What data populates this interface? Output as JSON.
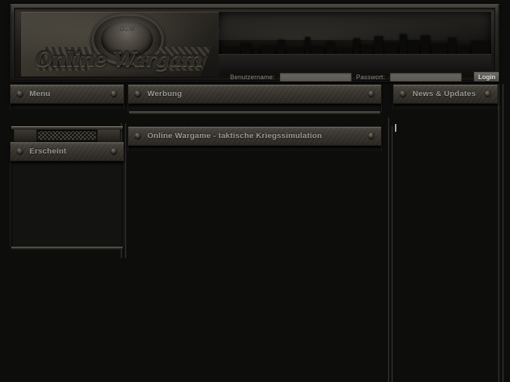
{
  "site": {
    "logo_text": "Online Wargame",
    "emblem_label": "OLW",
    "background_color": "#0d0d0c",
    "panel_header_color": "#423f38",
    "text_color": "#9c9a94"
  },
  "login": {
    "username_label": "Benutzername:",
    "username_value": "",
    "username_placeholder": "",
    "password_label": "Passwort:",
    "password_value": "",
    "password_placeholder": "",
    "submit_label": "Login"
  },
  "columns": {
    "left": {
      "panels": [
        {
          "title": "Menu",
          "body": ""
        },
        {
          "title": "Erscheint",
          "body": ""
        }
      ]
    },
    "middle": {
      "panels": [
        {
          "title": "Werbung",
          "body": ""
        },
        {
          "title": "Online Wargame - taktische Kriegssimulation",
          "body": ""
        }
      ]
    },
    "right": {
      "panels": [
        {
          "title": "News & Updates",
          "body": ""
        }
      ]
    }
  },
  "icons": {
    "rivet_left": "rivet-icon",
    "rivet_right": "rivet-icon",
    "grille": "grille-icon",
    "emblem": "emblem-icon"
  }
}
